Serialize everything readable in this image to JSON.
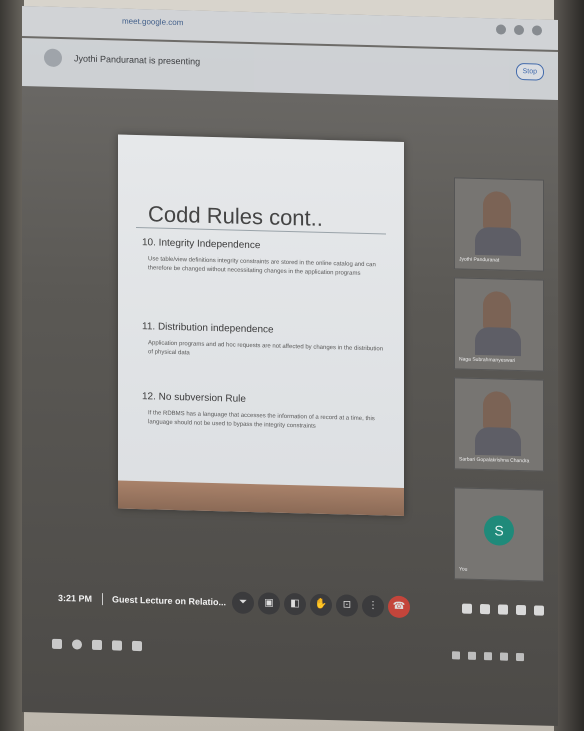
{
  "browser": {
    "url": "meet.google.com"
  },
  "presentation": {
    "presenter_status": "Jyothi Panduranat is presenting",
    "stop_label": "Stop"
  },
  "slide": {
    "title": "Codd Rules cont..",
    "sections": [
      {
        "heading": "10. Integrity Independence",
        "body": "Use table/view definitions integrity constraints are stored in the online catalog and can therefore be changed without necessitating changes in the application programs"
      },
      {
        "heading": "11. Distribution independence",
        "body": "Application programs and ad hoc requests are not affected by changes in the distribution of physical data"
      },
      {
        "heading": "12. No subversion Rule",
        "body": "If the RDBMS has a language that accesses the information of a record at a time, this language should not be used to bypass the integrity constraints"
      }
    ]
  },
  "participants": [
    {
      "name": "Jyothi Panduranat",
      "type": "video"
    },
    {
      "name": "Naga Subrahmanyeswari",
      "type": "video"
    },
    {
      "name": "Sarbari Gopalakrishna Chandra",
      "type": "video"
    },
    {
      "name": "You",
      "type": "avatar",
      "initial": "S",
      "color": "#1f8a7a"
    }
  ],
  "controls": {
    "time": "3:21 PM",
    "meeting_title": "Guest Lecture on Relatio...",
    "buttons": [
      "mic-icon",
      "camera-icon",
      "captions-icon",
      "raise-hand-icon",
      "present-icon",
      "more-icon",
      "end-call-icon"
    ],
    "right_buttons": [
      "info-icon",
      "people-icon",
      "chat-icon",
      "activities-icon",
      "lock-icon"
    ]
  }
}
